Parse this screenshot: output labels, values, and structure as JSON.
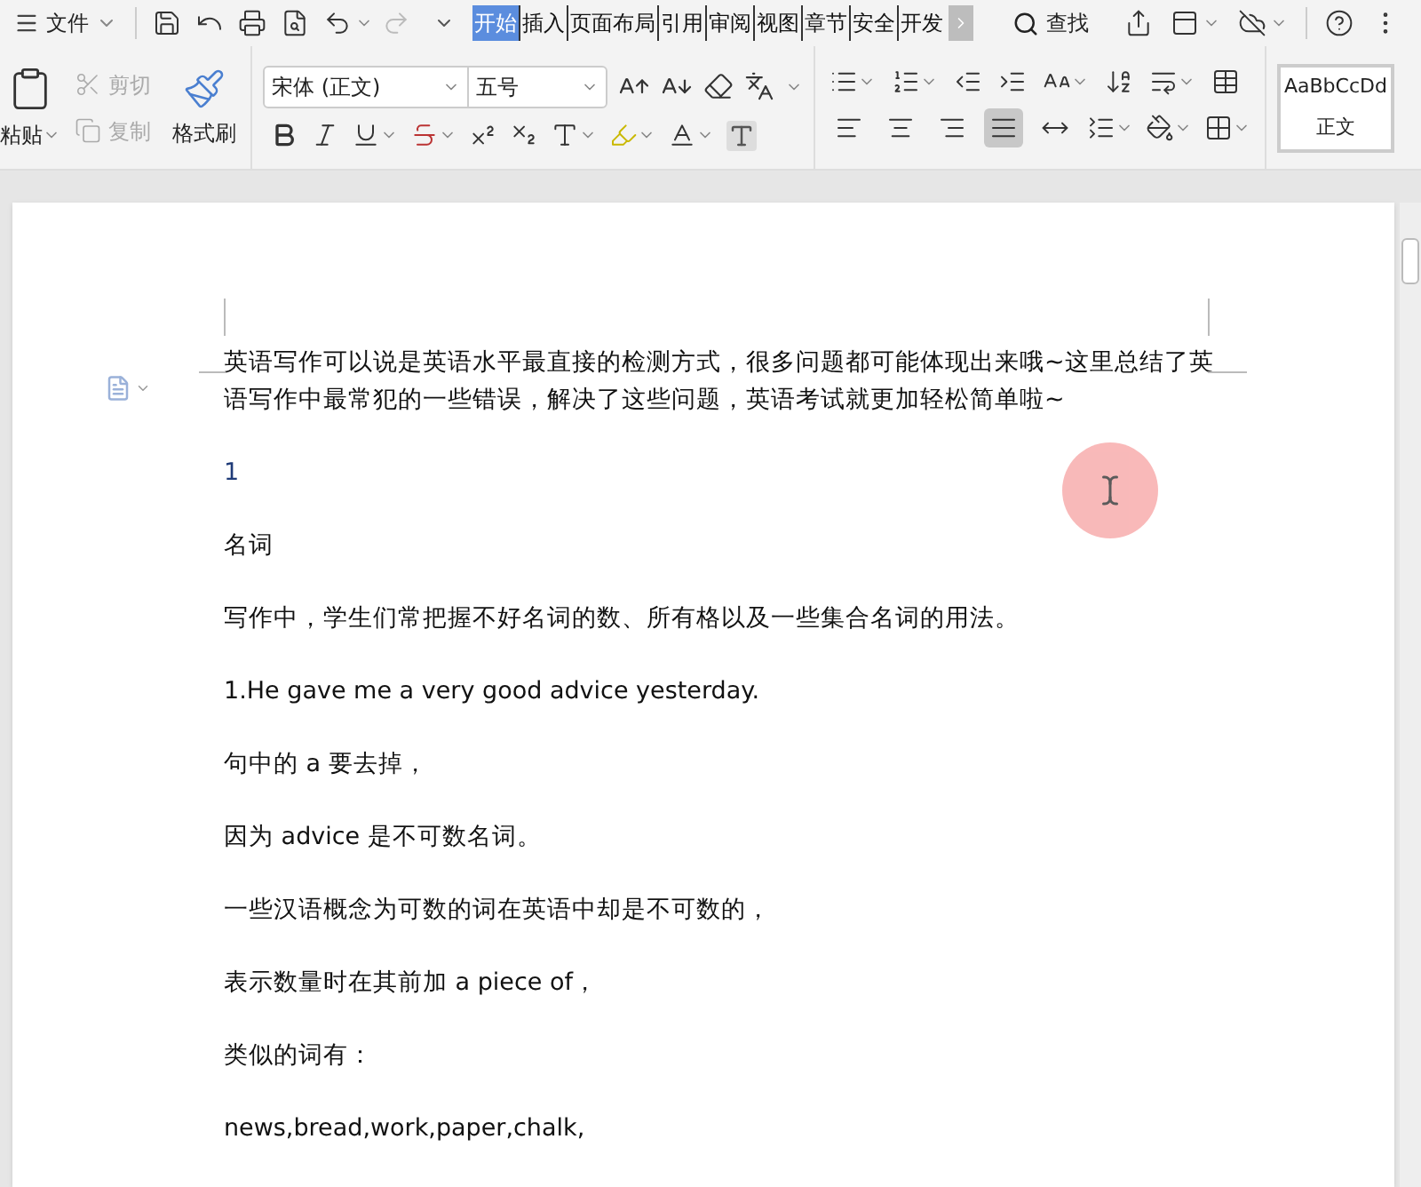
{
  "menu": {
    "file_label": "文件"
  },
  "tabs": [
    {
      "label": "开始",
      "selected": true
    },
    {
      "label": "插入",
      "selected": false
    },
    {
      "label": "页面布局",
      "selected": false
    },
    {
      "label": "引用",
      "selected": false
    },
    {
      "label": "审阅",
      "selected": false
    },
    {
      "label": "视图",
      "selected": false
    },
    {
      "label": "章节",
      "selected": false
    },
    {
      "label": "安全",
      "selected": false
    },
    {
      "label": "开发",
      "selected": false
    }
  ],
  "search": {
    "label": "查找"
  },
  "clipboard": {
    "paste": "粘贴",
    "format_painter": "格式刷",
    "small_buttons": [
      {
        "kind": "cut",
        "label": "剪切",
        "disabled": true
      },
      {
        "kind": "copy",
        "label": "复制",
        "disabled": true
      }
    ]
  },
  "font": {
    "name": "宋体 (正文)",
    "size": "五号"
  },
  "alignment": [
    {
      "kind": "left",
      "selected": false
    },
    {
      "kind": "center",
      "selected": false
    },
    {
      "kind": "right",
      "selected": false
    },
    {
      "kind": "justify",
      "selected": true
    },
    {
      "kind": "distributed",
      "selected": false
    }
  ],
  "style_preview": {
    "sample": "AaBbCcDd",
    "name": "正文"
  },
  "document": {
    "paragraphs": [
      {
        "kind": "body",
        "text": "英语写作可以说是英语水平最直接的检测方式，很多问题都可能体现出来哦~这里总结了英语写作中最常犯的一些错误，解决了这些问题，英语考试就更加轻松简单啦~"
      },
      {
        "kind": "number",
        "text": "1"
      },
      {
        "kind": "body",
        "text": "名词"
      },
      {
        "kind": "body",
        "text": "写作中，学生们常把握不好名词的数、所有格以及一些集合名词的用法。"
      },
      {
        "kind": "body",
        "text": "1.He gave me a very good advice yesterday."
      },
      {
        "kind": "body",
        "text": "句中的 a 要去掉，"
      },
      {
        "kind": "body",
        "text": "因为 advice 是不可数名词。"
      },
      {
        "kind": "body",
        "text": "一些汉语概念为可数的词在英语中却是不可数的，"
      },
      {
        "kind": "body",
        "text": "表示数量时在其前加 a piece of，"
      },
      {
        "kind": "body",
        "text": "类似的词有："
      },
      {
        "kind": "body",
        "text": "news,bread,work,paper,chalk,"
      }
    ]
  }
}
